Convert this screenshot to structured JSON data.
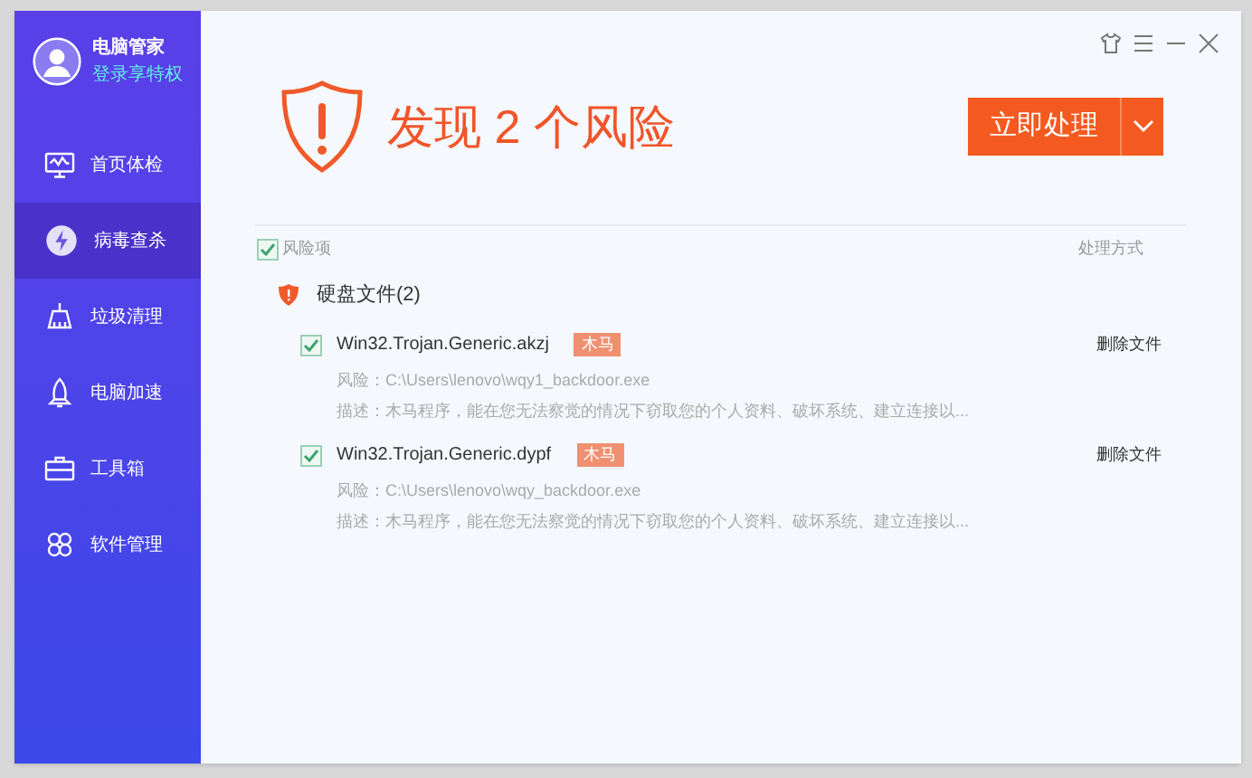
{
  "sidebar": {
    "user": {
      "name": "电脑管家",
      "login": "登录享特权"
    },
    "items": [
      {
        "label": "首页体检",
        "kind": "monitor",
        "selected": false
      },
      {
        "label": "病毒查杀",
        "kind": "virus",
        "selected": true
      },
      {
        "label": "垃圾清理",
        "kind": "broom",
        "selected": false
      },
      {
        "label": "电脑加速",
        "kind": "rocket",
        "selected": false
      },
      {
        "label": "工具箱",
        "kind": "toolbox",
        "selected": false
      },
      {
        "label": "软件管理",
        "kind": "apps",
        "selected": false
      }
    ]
  },
  "header": {
    "title": "发现 2 个风险",
    "action": "立即处理"
  },
  "list": {
    "select_all": {
      "label": "风险项",
      "checked": true
    },
    "column_action": "处理方式",
    "group": {
      "title": "硬盘文件(2)",
      "items": [
        {
          "name": "Win32.Trojan.Generic.akzj",
          "tag": "木马",
          "checked": true,
          "risk": "风险：C:\\Users\\lenovo\\wqy1_backdoor.exe",
          "desc": "描述：木马程序，能在您无法察觉的情况下窃取您的个人资料、破坏系统、建立连接以...",
          "action": "删除文件"
        },
        {
          "name": "Win32.Trojan.Generic.dypf",
          "tag": "木马",
          "checked": true,
          "risk": "风险：C:\\Users\\lenovo\\wqy_backdoor.exe",
          "desc": "描述：木马程序，能在您无法察觉的情况下窃取您的个人资料、破坏系统、建立连接以...",
          "action": "删除文件"
        }
      ]
    }
  }
}
